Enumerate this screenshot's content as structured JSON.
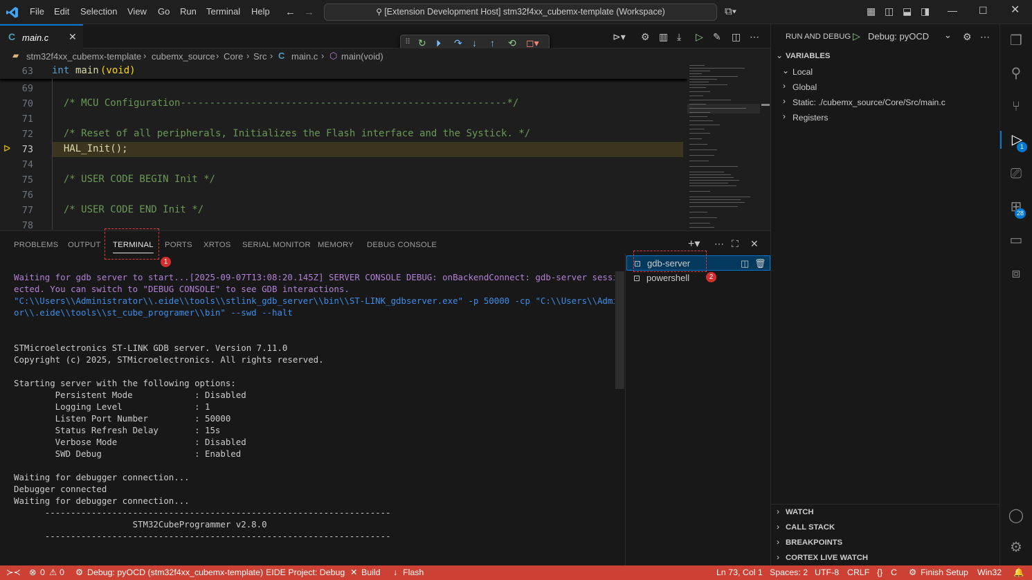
{
  "titlebar": {
    "menu": [
      "File",
      "Edit",
      "Selection",
      "View",
      "Go",
      "Run",
      "Terminal",
      "Help"
    ],
    "command_center": "[Extension Development Host] stm32f4xx_cubemx-template (Workspace)"
  },
  "editor": {
    "tab": {
      "label": "main.c",
      "icon": "c-file-icon"
    },
    "breadcrumb": [
      "stm32f4xx_cubemx-template",
      "cubemx_source",
      "Core",
      "Src",
      "main.c",
      "main(void)"
    ],
    "sticky": {
      "num": "63",
      "kw": "int",
      "fn": "main",
      "args": "(void)"
    },
    "lines": [
      {
        "num": "69",
        "text": ""
      },
      {
        "num": "70",
        "text": "  /* MCU Configuration--------------------------------------------------------*/"
      },
      {
        "num": "71",
        "text": ""
      },
      {
        "num": "72",
        "text": "  /* Reset of all peripherals, Initializes the Flash interface and the Systick. */"
      },
      {
        "num": "73",
        "text": "  HAL_Init();"
      },
      {
        "num": "74",
        "text": ""
      },
      {
        "num": "75",
        "text": "  /* USER CODE BEGIN Init */"
      },
      {
        "num": "76",
        "text": ""
      },
      {
        "num": "77",
        "text": "  /* USER CODE END Init */"
      },
      {
        "num": "78",
        "text": ""
      }
    ]
  },
  "panel": {
    "tabs": [
      "PROBLEMS",
      "OUTPUT",
      "TERMINAL",
      "PORTS",
      "XRTOS",
      "SERIAL MONITOR",
      "MEMORY",
      "DEBUG CONSOLE"
    ],
    "active_tab": "TERMINAL",
    "marker1": "1",
    "marker2": "2",
    "terminal_lines": [
      {
        "cls": "purple",
        "text": "Waiting for gdb server to start...[2025-09-07T13:08:20.145Z] SERVER CONSOLE DEBUG: onBackendConnect: gdb-server session conn"
      },
      {
        "cls": "purple",
        "text": "ected. You can switch to \"DEBUG CONSOLE\" to see GDB interactions."
      },
      {
        "cls": "blue",
        "text": "\"C:\\\\Users\\\\Administrator\\\\.eide\\\\tools\\\\stlink_gdb_server\\\\bin\\\\ST-LINK_gdbserver.exe\" -p 50000 -cp \"C:\\\\Users\\\\Administrat"
      },
      {
        "cls": "blue",
        "text": "or\\\\.eide\\\\tools\\\\st_cube_programer\\\\bin\" --swd --halt"
      },
      {
        "cls": "",
        "text": ""
      },
      {
        "cls": "",
        "text": ""
      },
      {
        "cls": "",
        "text": "STMicroelectronics ST-LINK GDB server. Version 7.11.0"
      },
      {
        "cls": "",
        "text": "Copyright (c) 2025, STMicroelectronics. All rights reserved."
      },
      {
        "cls": "",
        "text": ""
      },
      {
        "cls": "",
        "text": "Starting server with the following options:"
      },
      {
        "cls": "",
        "text": "        Persistent Mode            : Disabled"
      },
      {
        "cls": "",
        "text": "        Logging Level              : 1"
      },
      {
        "cls": "",
        "text": "        Listen Port Number         : 50000"
      },
      {
        "cls": "",
        "text": "        Status Refresh Delay       : 15s"
      },
      {
        "cls": "",
        "text": "        Verbose Mode               : Disabled"
      },
      {
        "cls": "",
        "text": "        SWD Debug                  : Enabled"
      },
      {
        "cls": "",
        "text": ""
      },
      {
        "cls": "",
        "text": "Waiting for debugger connection..."
      },
      {
        "cls": "",
        "text": "Debugger connected"
      },
      {
        "cls": "",
        "text": "Waiting for debugger connection..."
      },
      {
        "cls": "",
        "text": "      -------------------------------------------------------------------"
      },
      {
        "cls": "",
        "text": "                       STM32CubeProgrammer v2.8.0"
      },
      {
        "cls": "",
        "text": "      -------------------------------------------------------------------"
      }
    ],
    "terminals": [
      "gdb-server",
      "powershell"
    ]
  },
  "sidebar": {
    "title": "RUN AND DEBUG",
    "config": "Debug: pyOCD",
    "variables": "VARIABLES",
    "var_items": [
      "Local",
      "Global",
      "Static: ./cubemx_source/Core/Src/main.c",
      "Registers"
    ],
    "bottom_sections": [
      "WATCH",
      "CALL STACK",
      "BREAKPOINTS",
      "CORTEX LIVE WATCH"
    ]
  },
  "activity": {
    "debug_badge": "1",
    "ext_badge": "28"
  },
  "statusbar": {
    "errors": "0",
    "warnings": "0",
    "debug": "Debug: pyOCD (stm32f4xx_cubemx-template)",
    "eide": "EIDE Project: Debug",
    "build": "Build",
    "flash": "Flash",
    "position": "Ln 73, Col 1",
    "spaces": "Spaces: 2",
    "encoding": "UTF-8",
    "eol": "CRLF",
    "lang": "C",
    "finish": "Finish Setup",
    "platform": "Win32"
  },
  "colors": {
    "accent": "#0078d4",
    "statusbar": "#cc4133",
    "current_line": "#3c3520"
  }
}
